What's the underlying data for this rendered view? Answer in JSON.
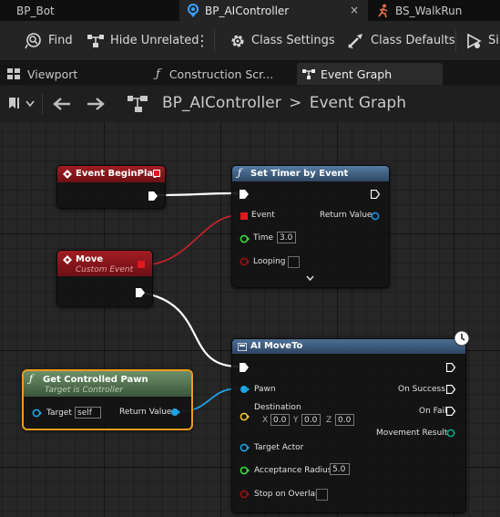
{
  "tabs": {
    "bp_bot": "BP_Bot",
    "bp_aicontroller": "BP_AIController",
    "close": "×",
    "bs_walkrun": "BS_WalkRun"
  },
  "toolbar": {
    "find": "Find",
    "hide_unrelated": "Hide Unrelated",
    "class_settings": "Class Settings",
    "class_defaults": "Class Defaults",
    "simulation": "Sin"
  },
  "subtabs": {
    "viewport": "Viewport",
    "construction": "Construction Scr...",
    "event_graph": "Event Graph"
  },
  "breadcrumb": {
    "blueprint": "BP_AIController",
    "separator": ">",
    "graph": "Event Graph"
  },
  "nodes": {
    "begin_play": {
      "title": "Event BeginPlay"
    },
    "move": {
      "title": "Move",
      "subtitle": "Custom Event"
    },
    "set_timer": {
      "title": "Set Timer by Event",
      "event": "Event",
      "return_value": "Return Value",
      "time_label": "Time",
      "time_value": "3.0",
      "looping": "Looping"
    },
    "get_pawn": {
      "title": "Get Controlled Pawn",
      "subtitle": "Target is Controller",
      "target": "Target",
      "target_value": "self",
      "return_value": "Return Value"
    },
    "ai_move": {
      "title": "AI MoveTo",
      "pawn": "Pawn",
      "on_success": "On Success",
      "destination": "Destination",
      "on_fail": "On Fail",
      "x": "X",
      "x_value": "0.0",
      "y": "Y",
      "y_value": "0.0",
      "z": "Z",
      "z_value": "0.0",
      "movement_result": "Movement Result",
      "target_actor": "Target Actor",
      "acceptance_radius": "Acceptance Radius",
      "acceptance_value": "5.0",
      "stop_on_overlap": "Stop on Overlap"
    }
  },
  "colors": {
    "exec": "#ffffff",
    "delegate": "#e0191e",
    "object": "#1fa3e4",
    "float": "#3adb3a",
    "bool": "#8b0000",
    "vector": "#f0c42a",
    "event_header": "#8a1418",
    "function_header": "#3c5878",
    "pure_header": "#4d6e4b",
    "selection": "#f09a1a"
  }
}
